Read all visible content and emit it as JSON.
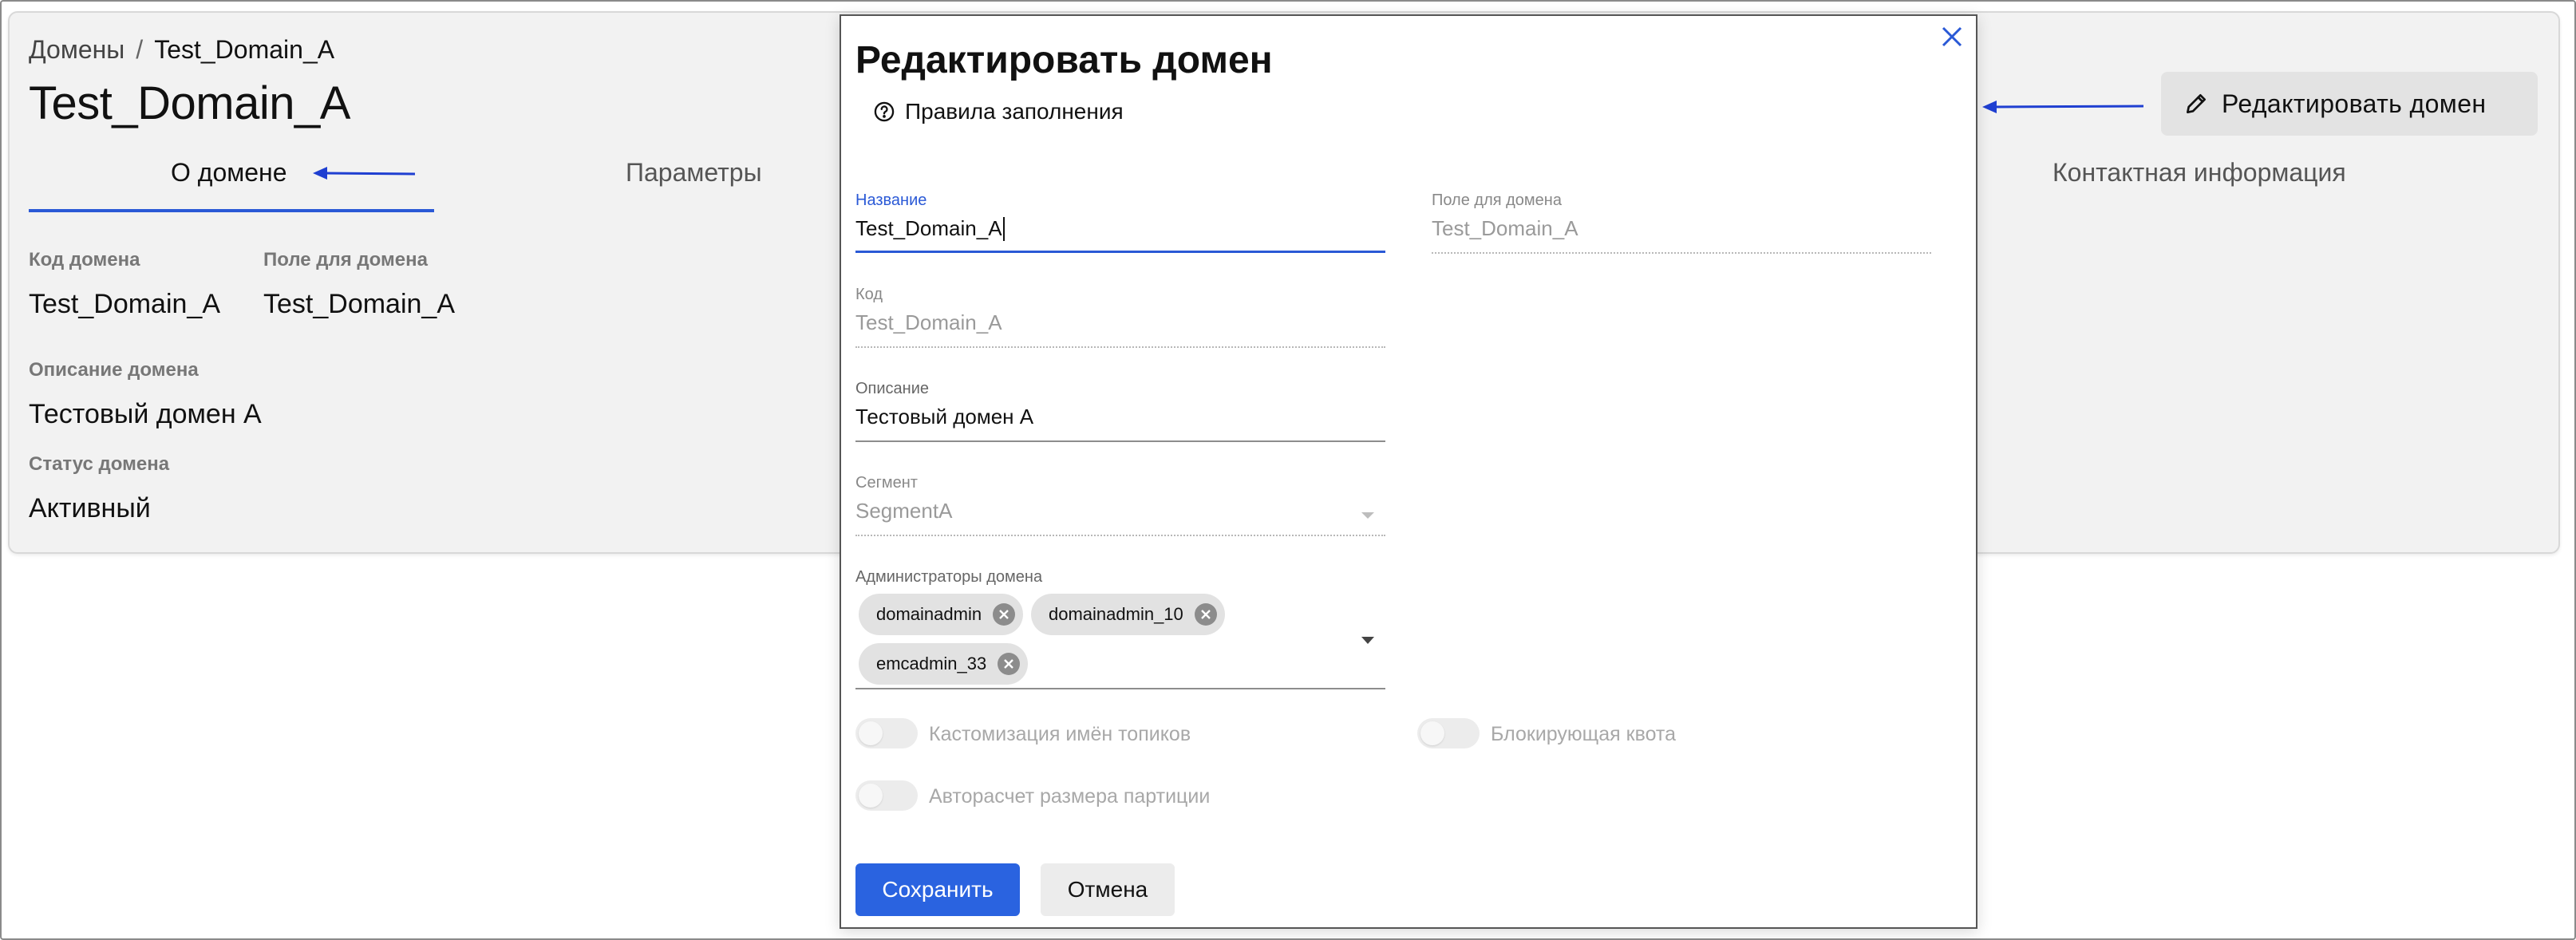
{
  "page": {
    "breadcrumb": {
      "root": "Домены",
      "separator": "/",
      "current": "Test_Domain_A"
    },
    "title": "Test_Domain_A",
    "tabs": [
      {
        "label": "О домене",
        "active": true
      },
      {
        "label": "Параметры",
        "active": false
      },
      {
        "label": "Контактная информация",
        "active": false
      }
    ],
    "fields": {
      "code_label": "Код домена",
      "code_value": "Test_Domain_A",
      "domain_field_label": "Поле для домена",
      "domain_field_value": "Test_Domain_A",
      "description_label": "Описание домена",
      "description_value": "Тестовый домен А",
      "status_label": "Статус домена",
      "status_value": "Активный"
    },
    "edit_button_label": "Редактировать домен"
  },
  "modal": {
    "title": "Редактировать домен",
    "rules_link": "Правила заполнения",
    "name": {
      "label": "Название",
      "value": "Test_Domain_A"
    },
    "domain_field": {
      "label": "Поле для домена",
      "value": "Test_Domain_A"
    },
    "code": {
      "label": "Код",
      "value": "Test_Domain_A"
    },
    "description": {
      "label": "Описание",
      "value": "Тестовый домен А"
    },
    "segment": {
      "label": "Сегмент",
      "value": "SegmentA"
    },
    "admins": {
      "label": "Администраторы домена",
      "chips": [
        "domainadmin",
        "domainadmin_10",
        "emcadmin_33"
      ]
    },
    "toggles": {
      "topic_names": "Кастомизация имён топиков",
      "blocking_quota": "Блокирующая квота",
      "partition_autocalc": "Авторасчет размера партиции"
    },
    "save_label": "Сохранить",
    "cancel_label": "Отмена"
  },
  "colors": {
    "accent": "#2a59d6",
    "primary_button": "#2a63e0",
    "annotation_arrow": "#1f3fd1"
  }
}
